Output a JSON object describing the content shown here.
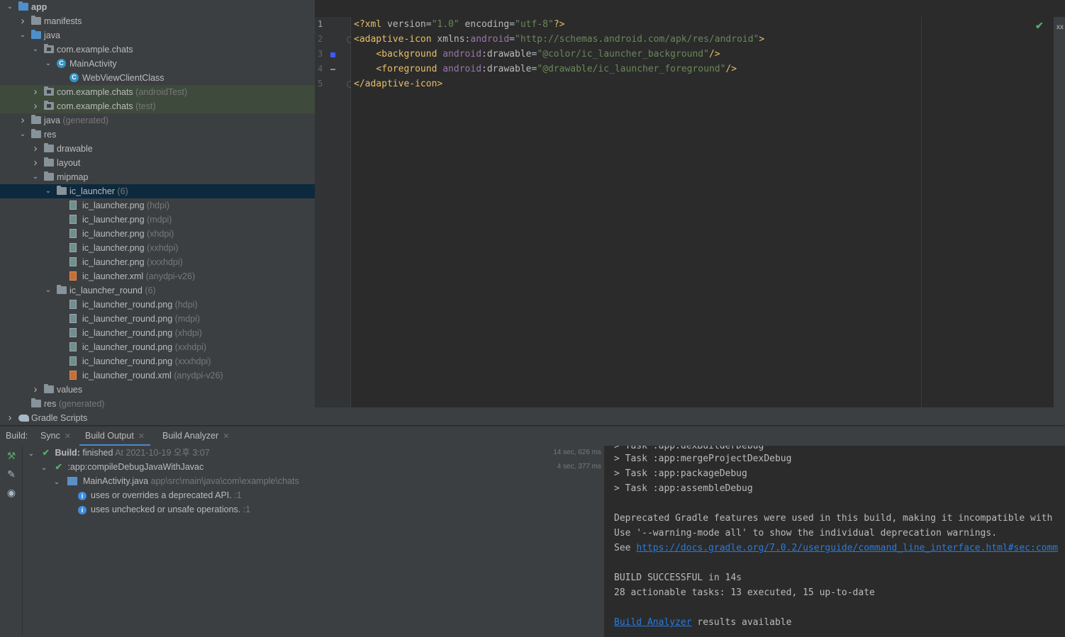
{
  "project_tree": {
    "items": [
      {
        "label": "app",
        "suffix": "",
        "depth": 0,
        "expanded": true,
        "icon": "module-folder-icon",
        "bold": true
      },
      {
        "label": "manifests",
        "suffix": "",
        "depth": 1,
        "expanded": false,
        "icon": "folder-icon"
      },
      {
        "label": "java",
        "suffix": "",
        "depth": 1,
        "expanded": true,
        "icon": "source-folder-icon"
      },
      {
        "label": "com.example.chats",
        "suffix": "",
        "depth": 2,
        "expanded": true,
        "icon": "package-icon"
      },
      {
        "label": "MainActivity",
        "suffix": "",
        "depth": 3,
        "expanded": true,
        "icon": "class-icon"
      },
      {
        "label": "WebViewClientClass",
        "suffix": "",
        "depth": 4,
        "expanded": null,
        "icon": "class-icon"
      },
      {
        "label": "com.example.chats",
        "suffix": "(androidTest)",
        "depth": 2,
        "expanded": false,
        "icon": "package-icon",
        "highlight": true
      },
      {
        "label": "com.example.chats",
        "suffix": "(test)",
        "depth": 2,
        "expanded": false,
        "icon": "package-icon",
        "highlight": true
      },
      {
        "label": "java",
        "suffix": "(generated)",
        "depth": 1,
        "expanded": false,
        "icon": "generated-folder-icon"
      },
      {
        "label": "res",
        "suffix": "",
        "depth": 1,
        "expanded": true,
        "icon": "resource-folder-icon"
      },
      {
        "label": "drawable",
        "suffix": "",
        "depth": 2,
        "expanded": false,
        "icon": "folder-icon"
      },
      {
        "label": "layout",
        "suffix": "",
        "depth": 2,
        "expanded": false,
        "icon": "folder-icon"
      },
      {
        "label": "mipmap",
        "suffix": "",
        "depth": 2,
        "expanded": true,
        "icon": "folder-icon"
      },
      {
        "label": "ic_launcher",
        "suffix": "(6)",
        "depth": 3,
        "expanded": true,
        "icon": "folder-icon",
        "selected": true
      },
      {
        "label": "ic_launcher.png",
        "suffix": "(hdpi)",
        "depth": 4,
        "expanded": null,
        "icon": "png-file-icon"
      },
      {
        "label": "ic_launcher.png",
        "suffix": "(mdpi)",
        "depth": 4,
        "expanded": null,
        "icon": "png-file-icon"
      },
      {
        "label": "ic_launcher.png",
        "suffix": "(xhdpi)",
        "depth": 4,
        "expanded": null,
        "icon": "png-file-icon"
      },
      {
        "label": "ic_launcher.png",
        "suffix": "(xxhdpi)",
        "depth": 4,
        "expanded": null,
        "icon": "png-file-icon"
      },
      {
        "label": "ic_launcher.png",
        "suffix": "(xxxhdpi)",
        "depth": 4,
        "expanded": null,
        "icon": "png-file-icon"
      },
      {
        "label": "ic_launcher.xml",
        "suffix": "(anydpi-v26)",
        "depth": 4,
        "expanded": null,
        "icon": "xml-file-icon"
      },
      {
        "label": "ic_launcher_round",
        "suffix": "(6)",
        "depth": 3,
        "expanded": true,
        "icon": "folder-icon"
      },
      {
        "label": "ic_launcher_round.png",
        "suffix": "(hdpi)",
        "depth": 4,
        "expanded": null,
        "icon": "png-file-icon"
      },
      {
        "label": "ic_launcher_round.png",
        "suffix": "(mdpi)",
        "depth": 4,
        "expanded": null,
        "icon": "png-file-icon"
      },
      {
        "label": "ic_launcher_round.png",
        "suffix": "(xhdpi)",
        "depth": 4,
        "expanded": null,
        "icon": "png-file-icon"
      },
      {
        "label": "ic_launcher_round.png",
        "suffix": "(xxhdpi)",
        "depth": 4,
        "expanded": null,
        "icon": "png-file-icon"
      },
      {
        "label": "ic_launcher_round.png",
        "suffix": "(xxxhdpi)",
        "depth": 4,
        "expanded": null,
        "icon": "png-file-icon"
      },
      {
        "label": "ic_launcher_round.xml",
        "suffix": "(anydpi-v26)",
        "depth": 4,
        "expanded": null,
        "icon": "xml-file-icon"
      },
      {
        "label": "values",
        "suffix": "",
        "depth": 2,
        "expanded": false,
        "icon": "folder-icon"
      },
      {
        "label": "res",
        "suffix": "(generated)",
        "depth": 1,
        "expanded": null,
        "icon": "generated-folder-icon"
      },
      {
        "label": "Gradle Scripts",
        "suffix": "",
        "depth": 0,
        "expanded": false,
        "icon": "gradle-icon"
      }
    ]
  },
  "editor": {
    "line_numbers": [
      "1",
      "2",
      "3",
      "4",
      "5"
    ],
    "lines": [
      [
        {
          "c": "k",
          "t": "<?xml "
        },
        {
          "c": "a",
          "t": "version"
        },
        {
          "c": "t",
          "t": "="
        },
        {
          "c": "s",
          "t": "\"1.0\""
        },
        {
          "c": "a",
          "t": " encoding"
        },
        {
          "c": "t",
          "t": "="
        },
        {
          "c": "s",
          "t": "\"utf-8\""
        },
        {
          "c": "k",
          "t": "?>"
        }
      ],
      [
        {
          "c": "k",
          "t": "<adaptive-icon "
        },
        {
          "c": "a",
          "t": "xmlns:"
        },
        {
          "c": "ns",
          "t": "android"
        },
        {
          "c": "t",
          "t": "="
        },
        {
          "c": "s",
          "t": "\"http://schemas.android.com/apk/res/android\""
        },
        {
          "c": "k",
          "t": ">"
        }
      ],
      [
        {
          "c": "t",
          "t": "    "
        },
        {
          "c": "k",
          "t": "<background "
        },
        {
          "c": "ns",
          "t": "android"
        },
        {
          "c": "a",
          "t": ":drawable"
        },
        {
          "c": "t",
          "t": "="
        },
        {
          "c": "s",
          "t": "\"@color/ic_launcher_background\""
        },
        {
          "c": "k",
          "t": "/>"
        }
      ],
      [
        {
          "c": "t",
          "t": "    "
        },
        {
          "c": "k",
          "t": "<foreground "
        },
        {
          "c": "ns",
          "t": "android"
        },
        {
          "c": "a",
          "t": ":drawable"
        },
        {
          "c": "t",
          "t": "="
        },
        {
          "c": "s",
          "t": "\"@drawable/ic_launcher_foreground\""
        },
        {
          "c": "k",
          "t": "/>"
        }
      ],
      [
        {
          "c": "k",
          "t": "</adaptive-icon>"
        }
      ]
    ],
    "status_check": "✔",
    "right_label": "xx"
  },
  "build": {
    "label": "Build:",
    "tabs": [
      {
        "label": "Sync",
        "active": false
      },
      {
        "label": "Build Output",
        "active": true
      },
      {
        "label": "Build Analyzer",
        "active": false
      }
    ],
    "tree": {
      "root_title": "Build:",
      "root_text": " finished",
      "root_time": " At 2021-10-19 오후 3:07",
      "root_duration": "14 sec, 626 ms",
      "task": ":app:compileDebugJavaWithJavac",
      "task_duration": "4 sec, 377 ms",
      "file": "MainActivity.java",
      "file_path": " app\\src\\main\\java\\com\\example\\chats",
      "messages": [
        {
          "text": "uses or overrides a deprecated API.",
          "line": " :1"
        },
        {
          "text": "uses unchecked or unsafe operations.",
          "line": " :1"
        }
      ]
    },
    "console": {
      "lines": [
        "> Task :app:dexBuilderDebug",
        "> Task :app:mergeProjectDexDebug",
        "> Task :app:packageDebug",
        "> Task :app:assembleDebug",
        "",
        "Deprecated Gradle features were used in this build, making it incompatible with",
        "Use '--warning-mode all' to show the individual deprecation warnings.",
        "",
        "",
        "BUILD SUCCESSFUL in 14s",
        "28 actionable tasks: 13 executed, 15 up-to-date",
        "",
        ""
      ],
      "see_prefix": "See ",
      "see_link": "https://docs.gradle.org/7.0.2/userguide/command_line_interface.html#sec:comm",
      "analyzer_link": "Build Analyzer",
      "analyzer_suffix": " results available"
    }
  }
}
